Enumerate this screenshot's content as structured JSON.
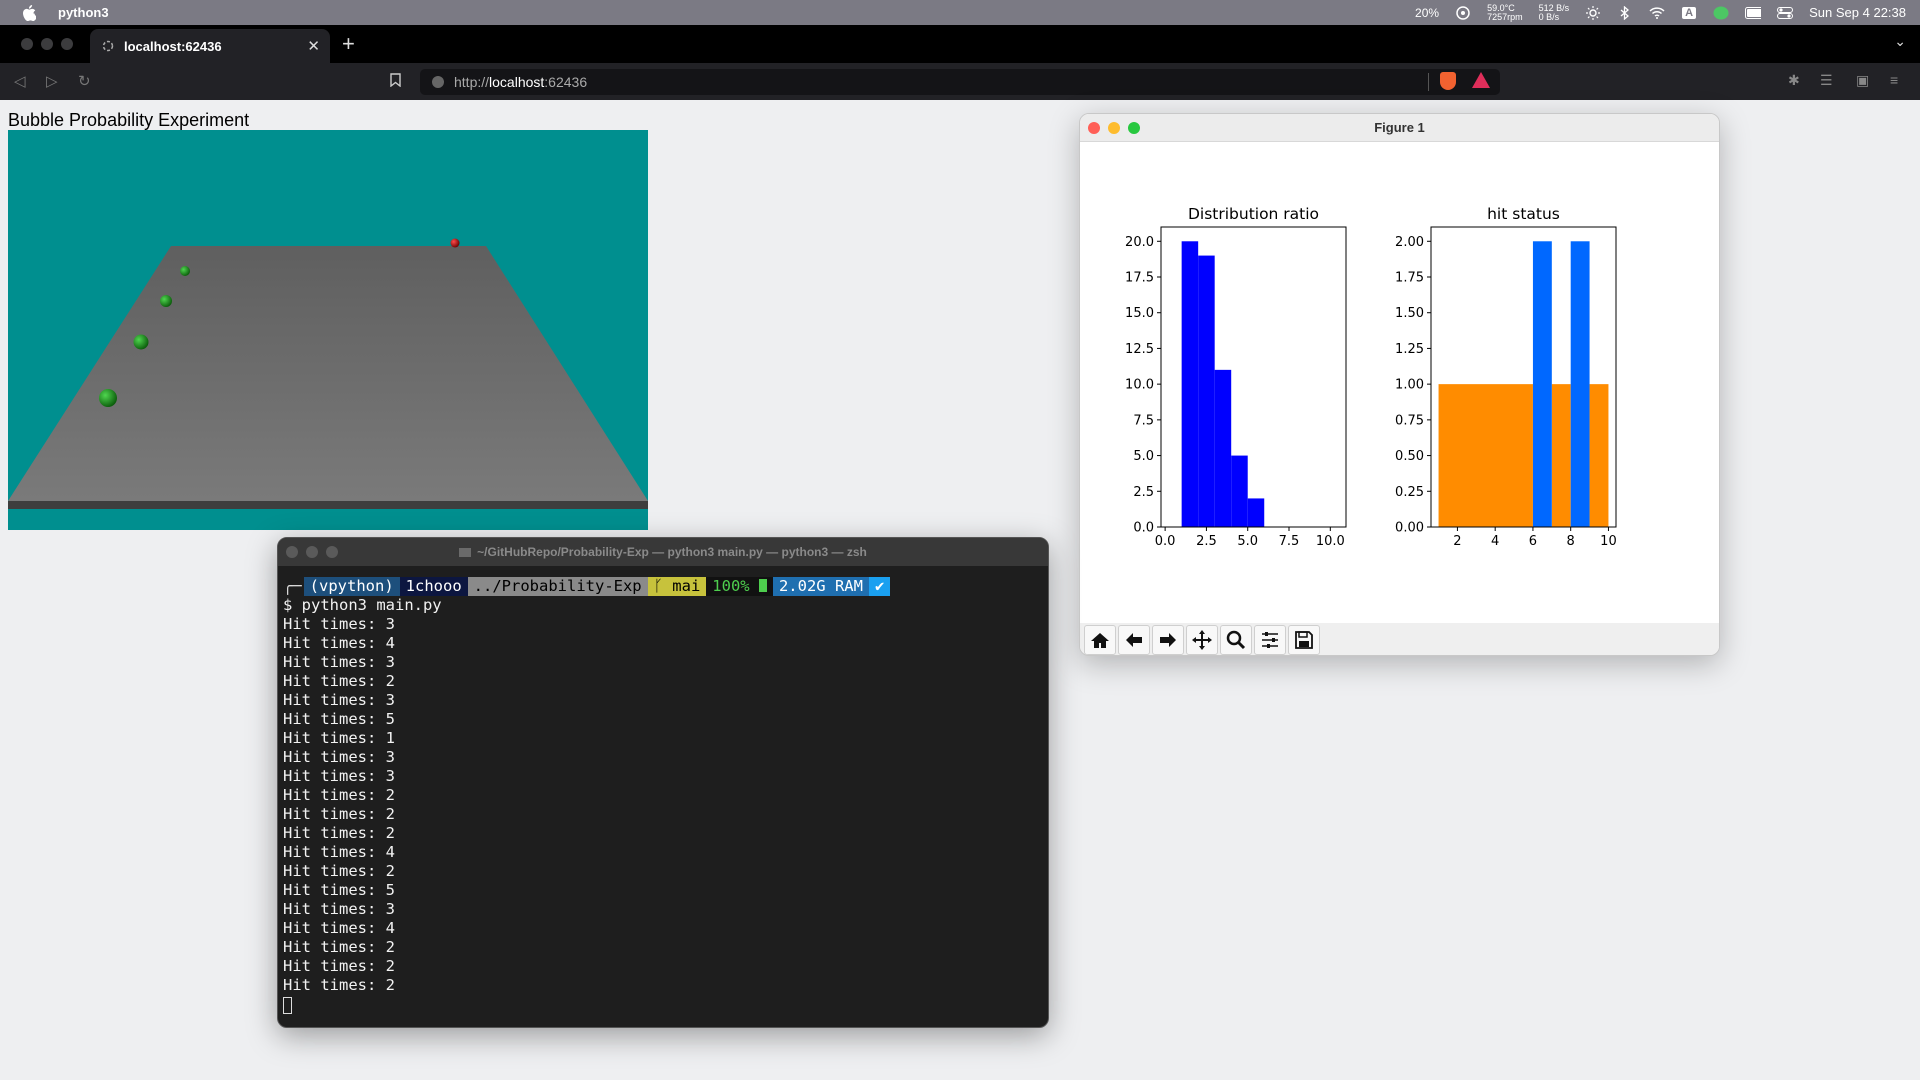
{
  "menubar": {
    "app_name": "python3",
    "cpu": "20%",
    "temp": "59.0°C",
    "rpm": "7257rpm",
    "net_up": "512 B/s",
    "net_down": "0 B/s",
    "input_source": "A",
    "datetime": "Sun Sep 4  22:38"
  },
  "browser": {
    "tab_title": "localhost:62436",
    "url_prefix": "http://",
    "url_host": "localhost",
    "url_suffix": ":62436"
  },
  "page": {
    "title": "Bubble Probability Experiment"
  },
  "figure": {
    "window_title": "Figure 1",
    "toolbar": [
      "home-icon",
      "back-arrow-icon",
      "forward-arrow-icon",
      "pan-icon",
      "zoom-icon",
      "configure-icon",
      "save-icon"
    ]
  },
  "chart_data": [
    {
      "type": "bar",
      "title": "Distribution ratio",
      "xlim": [
        -0.25,
        10.95
      ],
      "ylim": [
        0,
        21
      ],
      "xticks": [
        "0.0",
        "2.5",
        "5.0",
        "7.5",
        "10.0"
      ],
      "yticks": [
        "0.0",
        "2.5",
        "5.0",
        "7.5",
        "10.0",
        "12.5",
        "15.0",
        "17.5",
        "20.0"
      ],
      "bins": [
        [
          1,
          2
        ],
        [
          2,
          3
        ],
        [
          3,
          4
        ],
        [
          4,
          5
        ],
        [
          5,
          6
        ]
      ],
      "values": [
        20,
        19,
        11,
        5,
        2
      ],
      "color": "#0000ff"
    },
    {
      "type": "bar",
      "title": "hit status",
      "xlim": [
        0.6,
        10.4
      ],
      "ylim": [
        0,
        2.1
      ],
      "xticks": [
        "2",
        "4",
        "6",
        "8",
        "10"
      ],
      "yticks": [
        "0.00",
        "0.25",
        "0.50",
        "0.75",
        "1.00",
        "1.25",
        "1.50",
        "1.75",
        "2.00"
      ],
      "series": [
        {
          "color": "#ff8c00",
          "bins": [
            [
              1,
              6
            ],
            [
              7,
              8
            ],
            [
              9,
              10
            ]
          ],
          "values": [
            1,
            1,
            1
          ]
        },
        {
          "color": "#0068ff",
          "bins": [
            [
              6,
              7
            ],
            [
              8,
              9
            ]
          ],
          "values": [
            2,
            2
          ]
        }
      ]
    }
  ],
  "terminal": {
    "title": "~/GitHubRepo/Probability-Exp — python3 main.py — python3 — zsh",
    "prompt": {
      "venv": "(vpython)",
      "user": "1chooo",
      "path": "../Probability-Exp",
      "git": "ᚴ mai",
      "battery": "100%",
      "ram": "2.02G RAM",
      "status": "✔"
    },
    "command": "$ python3 main.py",
    "output": [
      "Hit times: 3",
      "Hit times: 4",
      "Hit times: 3",
      "Hit times: 2",
      "Hit times: 3",
      "Hit times: 5",
      "Hit times: 1",
      "Hit times: 3",
      "Hit times: 3",
      "Hit times: 2",
      "Hit times: 2",
      "Hit times: 2",
      "Hit times: 4",
      "Hit times: 2",
      "Hit times: 5",
      "Hit times: 3",
      "Hit times: 4",
      "Hit times: 2",
      "Hit times: 2",
      "Hit times: 2"
    ]
  }
}
